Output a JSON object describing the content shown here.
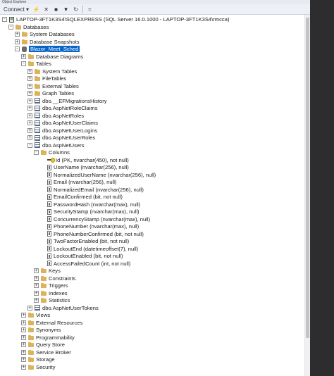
{
  "window": {
    "title": "Object Explorer"
  },
  "toolbar": {
    "connect_label": "Connect ▾"
  },
  "tree": [
    {
      "text": "LAPTOP-3FT1K3S4\\SQLEXPRESS (SQL Server 16.0.1000 - LAPTOP-3FT1K3S4\\rmcca)",
      "level": 0,
      "icon": "server",
      "exp": "-"
    },
    {
      "text": "Databases",
      "level": 1,
      "icon": "folder",
      "exp": "-"
    },
    {
      "text": "System Databases",
      "level": 2,
      "icon": "folder",
      "exp": "+"
    },
    {
      "text": "Database Snapshots",
      "level": 2,
      "icon": "folder",
      "exp": "+"
    },
    {
      "text": "Blazor_Meet_Sched",
      "level": 2,
      "icon": "db",
      "exp": "-",
      "selected": true
    },
    {
      "text": "Database Diagrams",
      "level": 3,
      "icon": "folder",
      "exp": "+"
    },
    {
      "text": "Tables",
      "level": 3,
      "icon": "folder",
      "exp": "-"
    },
    {
      "text": "System Tables",
      "level": 4,
      "icon": "folder",
      "exp": "+"
    },
    {
      "text": "FileTables",
      "level": 4,
      "icon": "folder",
      "exp": "+"
    },
    {
      "text": "External Tables",
      "level": 4,
      "icon": "folder",
      "exp": "+"
    },
    {
      "text": "Graph Tables",
      "level": 4,
      "icon": "folder",
      "exp": "+"
    },
    {
      "text": "dbo.__EFMigrationsHistory",
      "level": 4,
      "icon": "table",
      "exp": "+"
    },
    {
      "text": "dbo.AspNetRoleClaims",
      "level": 4,
      "icon": "table",
      "exp": "+"
    },
    {
      "text": "dbo.AspNetRoles",
      "level": 4,
      "icon": "table",
      "exp": "+"
    },
    {
      "text": "dbo.AspNetUserClaims",
      "level": 4,
      "icon": "table",
      "exp": "+"
    },
    {
      "text": "dbo.AspNetUserLogins",
      "level": 4,
      "icon": "table",
      "exp": "+"
    },
    {
      "text": "dbo.AspNetUserRoles",
      "level": 4,
      "icon": "table",
      "exp": "+"
    },
    {
      "text": "dbo.AspNetUsers",
      "level": 4,
      "icon": "table",
      "exp": "-"
    },
    {
      "text": "Columns",
      "level": 5,
      "icon": "folder",
      "exp": "-"
    },
    {
      "text": "Id (PK, nvarchar(450), not null)",
      "level": 6,
      "icon": "key",
      "exp": ""
    },
    {
      "text": "UserName (nvarchar(256), null)",
      "level": 6,
      "icon": "column",
      "exp": ""
    },
    {
      "text": "NormalizedUserName (nvarchar(256), null)",
      "level": 6,
      "icon": "column",
      "exp": ""
    },
    {
      "text": "Email (nvarchar(256), null)",
      "level": 6,
      "icon": "column",
      "exp": ""
    },
    {
      "text": "NormalizedEmail (nvarchar(256), null)",
      "level": 6,
      "icon": "column",
      "exp": ""
    },
    {
      "text": "EmailConfirmed (bit, not null)",
      "level": 6,
      "icon": "column",
      "exp": ""
    },
    {
      "text": "PasswordHash (nvarchar(max), null)",
      "level": 6,
      "icon": "column",
      "exp": ""
    },
    {
      "text": "SecurityStamp (nvarchar(max), null)",
      "level": 6,
      "icon": "column",
      "exp": ""
    },
    {
      "text": "ConcurrencyStamp (nvarchar(max), null)",
      "level": 6,
      "icon": "column",
      "exp": ""
    },
    {
      "text": "PhoneNumber (nvarchar(max), null)",
      "level": 6,
      "icon": "column",
      "exp": ""
    },
    {
      "text": "PhoneNumberConfirmed (bit, not null)",
      "level": 6,
      "icon": "column",
      "exp": ""
    },
    {
      "text": "TwoFactorEnabled (bit, not null)",
      "level": 6,
      "icon": "column",
      "exp": ""
    },
    {
      "text": "LockoutEnd (datetimeoffset(7), null)",
      "level": 6,
      "icon": "column",
      "exp": ""
    },
    {
      "text": "LockoutEnabled (bit, not null)",
      "level": 6,
      "icon": "column",
      "exp": ""
    },
    {
      "text": "AccessFailedCount (int, not null)",
      "level": 6,
      "icon": "column",
      "exp": ""
    },
    {
      "text": "Keys",
      "level": 5,
      "icon": "folder",
      "exp": "+"
    },
    {
      "text": "Constraints",
      "level": 5,
      "icon": "folder",
      "exp": "+"
    },
    {
      "text": "Triggers",
      "level": 5,
      "icon": "folder",
      "exp": "+"
    },
    {
      "text": "Indexes",
      "level": 5,
      "icon": "folder",
      "exp": "+"
    },
    {
      "text": "Statistics",
      "level": 5,
      "icon": "folder",
      "exp": "+"
    },
    {
      "text": "dbo.AspNetUserTokens",
      "level": 4,
      "icon": "table",
      "exp": "+"
    },
    {
      "text": "Views",
      "level": 3,
      "icon": "folder",
      "exp": "+"
    },
    {
      "text": "External Resources",
      "level": 3,
      "icon": "folder",
      "exp": "+"
    },
    {
      "text": "Synonyms",
      "level": 3,
      "icon": "folder",
      "exp": "+"
    },
    {
      "text": "Programmability",
      "level": 3,
      "icon": "folder",
      "exp": "+"
    },
    {
      "text": "Query Store",
      "level": 3,
      "icon": "folder",
      "exp": "+"
    },
    {
      "text": "Service Broker",
      "level": 3,
      "icon": "folder",
      "exp": "+"
    },
    {
      "text": "Storage",
      "level": 3,
      "icon": "folder",
      "exp": "+"
    },
    {
      "text": "Security",
      "level": 3,
      "icon": "folder",
      "exp": "+"
    }
  ]
}
